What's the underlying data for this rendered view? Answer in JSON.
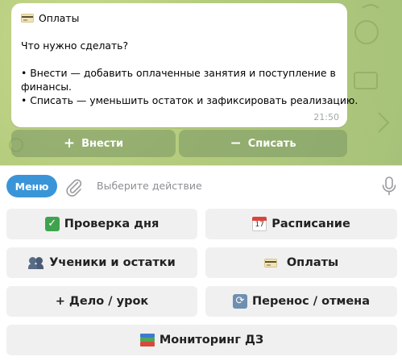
{
  "message": {
    "title": "Оплаты",
    "question": "Что нужно сделать?",
    "bullet1_line1": "• Внести — добавить оплаченные занятия и поступление в",
    "bullet1_line2": "финансы.",
    "bullet2": "• Списать — уменьшить остаток и зафиксировать реализацию.",
    "time": "21:50"
  },
  "inline_buttons": [
    {
      "icon": "plus",
      "label": "Внести"
    },
    {
      "icon": "minus",
      "label": "Списать"
    }
  ],
  "input_bar": {
    "menu_label": "Меню",
    "placeholder": "Выберите действие"
  },
  "keyboard": {
    "rows": [
      [
        {
          "icon": "check-icon",
          "label": "Проверка дня"
        },
        {
          "icon": "calendar-icon",
          "label": "Расписание"
        }
      ],
      [
        {
          "icon": "people-icon",
          "label": "Ученики и остатки"
        },
        {
          "icon": "credit-card-icon",
          "label": "Оплаты"
        }
      ],
      [
        {
          "icon": "",
          "label": "+ Дело / урок"
        },
        {
          "icon": "repeat-icon",
          "label": "Перенос / отмена"
        }
      ],
      [
        {
          "icon": "books-icon",
          "label": "Мониторинг ДЗ"
        }
      ]
    ]
  },
  "colors": {
    "menu_button": "#3a95d8",
    "chat_background": "#b5cc7d",
    "keyboard_button": "#f0f0f0"
  }
}
